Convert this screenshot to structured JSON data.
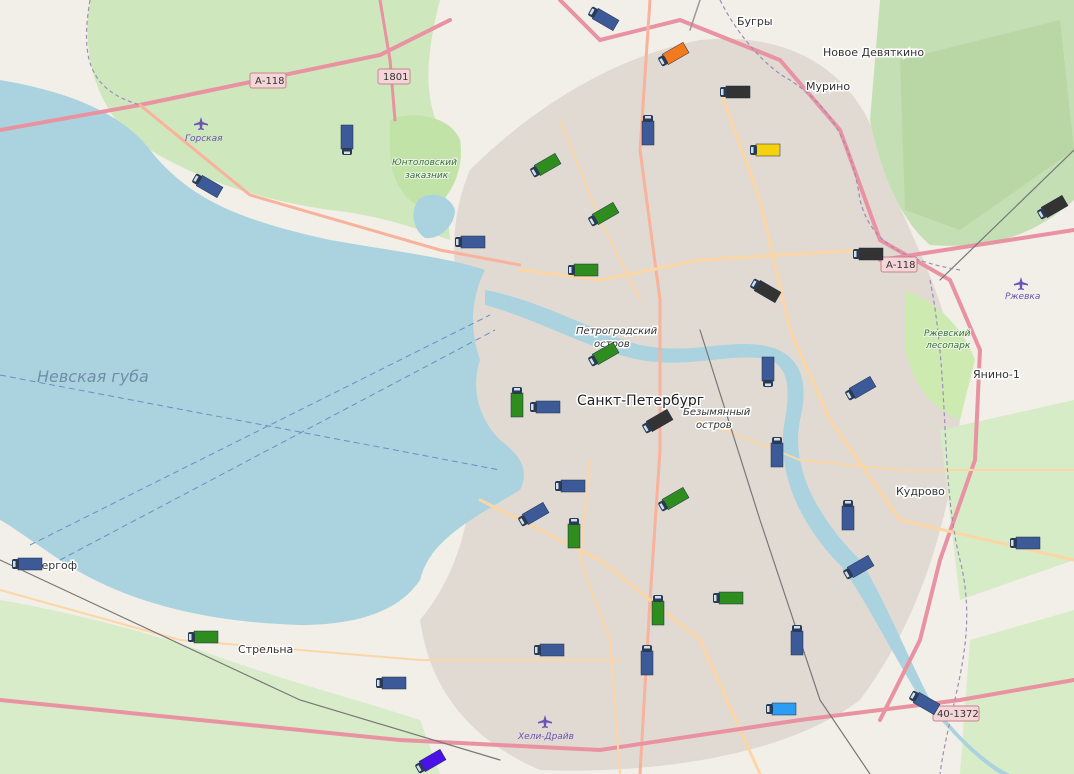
{
  "map": {
    "place_labels": {
      "gulf": "Невская губа",
      "city": "Санкт-Петербург",
      "bugry": "Бугры",
      "novoe_devyatkino": "Новое Девяткино",
      "murino": "Мурино",
      "gorskaya": "Горская",
      "yuntolovsky_1": "Юнтоловский",
      "yuntolovsky_2": "заказник",
      "petrogradsky_1": "Петроградский",
      "petrogradsky_2": "остров",
      "bezymyanny_1": "Безымянный",
      "bezymyanny_2": "остров",
      "rzhevsky_park_1": "Ржевский",
      "rzhevsky_park_2": "лесопарк",
      "rzhevka": "Ржевка",
      "yanino": "Янино-1",
      "kudrovo": "Кудрово",
      "petergof": "Петергоф",
      "strelna": "Стрельна",
      "heli_drive": "Хели-Драйв"
    },
    "road_shields": {
      "a118_west": "А-118",
      "r1801": "1801",
      "a118_east": "А-118",
      "r40_1372": "40-1372"
    },
    "colors": {
      "water": "#aad3df",
      "land": "#f2efe9",
      "park": "#cdebb0",
      "forest": "#add19e",
      "motorway": "#e892a2",
      "trunk": "#f9b29c",
      "primary": "#fcd6a4",
      "urban": "#d9d0c9",
      "truck_blue": "#3d5a98",
      "truck_green": "#2f8c1f",
      "truck_black": "#333333",
      "truck_orange": "#f07a1c",
      "truck_yellow": "#f5d20f",
      "truck_light_blue": "#2a9df4",
      "truck_violet": "#4a12e8"
    },
    "vehicles": [
      {
        "id": "v1",
        "color": "blue",
        "heading": "south-east"
      },
      {
        "id": "v2",
        "color": "orange",
        "heading": "north-east"
      },
      {
        "id": "v3",
        "color": "black",
        "heading": "east"
      },
      {
        "id": "v4",
        "color": "blue",
        "heading": "south"
      },
      {
        "id": "v5",
        "color": "yellow",
        "heading": "east"
      },
      {
        "id": "v6",
        "color": "blue",
        "heading": "north"
      },
      {
        "id": "v7",
        "color": "blue",
        "heading": "south-east"
      },
      {
        "id": "v8",
        "color": "green",
        "heading": "north-east"
      },
      {
        "id": "v9",
        "color": "green",
        "heading": "north-east"
      },
      {
        "id": "v10",
        "color": "blue",
        "heading": "east"
      },
      {
        "id": "v11",
        "color": "green",
        "heading": "east"
      },
      {
        "id": "v12",
        "color": "black",
        "heading": "east"
      },
      {
        "id": "v13",
        "color": "black",
        "heading": "south-east"
      },
      {
        "id": "v14",
        "color": "black",
        "heading": "north-east"
      },
      {
        "id": "v15",
        "color": "green",
        "heading": "north-east"
      },
      {
        "id": "v16",
        "color": "blue",
        "heading": "north"
      },
      {
        "id": "v17",
        "color": "green",
        "heading": "south"
      },
      {
        "id": "v18",
        "color": "blue",
        "heading": "east"
      },
      {
        "id": "v19",
        "color": "black",
        "heading": "north-east"
      },
      {
        "id": "v20",
        "color": "blue",
        "heading": "north-east"
      },
      {
        "id": "v21",
        "color": "blue",
        "heading": "south"
      },
      {
        "id": "v22",
        "color": "blue",
        "heading": "east"
      },
      {
        "id": "v23",
        "color": "blue",
        "heading": "north-east"
      },
      {
        "id": "v24",
        "color": "green",
        "heading": "north-east"
      },
      {
        "id": "v25",
        "color": "green",
        "heading": "south"
      },
      {
        "id": "v26",
        "color": "blue",
        "heading": "south"
      },
      {
        "id": "v27",
        "color": "blue",
        "heading": "east"
      },
      {
        "id": "v28",
        "color": "blue",
        "heading": "north-east"
      },
      {
        "id": "v29",
        "color": "blue",
        "heading": "east"
      },
      {
        "id": "v30",
        "color": "green",
        "heading": "east"
      },
      {
        "id": "v31",
        "color": "green",
        "heading": "south"
      },
      {
        "id": "v32",
        "color": "green",
        "heading": "east"
      },
      {
        "id": "v33",
        "color": "blue",
        "heading": "east"
      },
      {
        "id": "v34",
        "color": "blue",
        "heading": "south"
      },
      {
        "id": "v35",
        "color": "blue",
        "heading": "south"
      },
      {
        "id": "v36",
        "color": "blue",
        "heading": "east"
      },
      {
        "id": "v37",
        "color": "light_blue",
        "heading": "east"
      },
      {
        "id": "v38",
        "color": "blue",
        "heading": "south-east"
      },
      {
        "id": "v39",
        "color": "violet",
        "heading": "north-east"
      },
      {
        "id": "v40",
        "color": "blue",
        "heading": "east"
      },
      {
        "id": "v41",
        "color": "blue",
        "heading": "south-east"
      }
    ]
  }
}
